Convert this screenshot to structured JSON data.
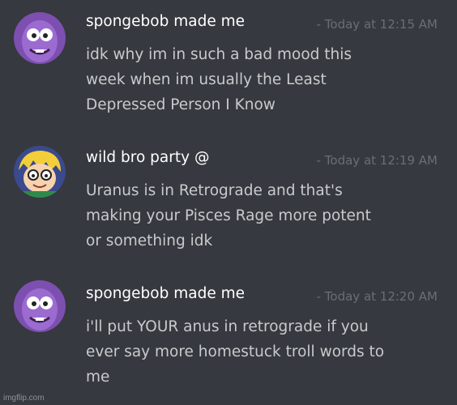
{
  "colors": {
    "background": "#36393f",
    "username": "#ffffff",
    "message_text": "#c9cacc",
    "timestamp": "#6a6e75"
  },
  "messages": [
    {
      "username": "spongebob made me",
      "timestamp": "- Today at 12:15 AM",
      "avatar": "purple-cartoon-character-avatar",
      "lines": [
        "idk why im in such a bad mood this",
        "week when im usually the Least",
        "Depressed Person I Know"
      ]
    },
    {
      "username": "wild bro party @",
      "timestamp": "- Today at 12:19 AM",
      "avatar": "blonde-cartoon-character-avatar",
      "lines": [
        "Uranus is in Retrograde and that's",
        "making your Pisces Rage more potent",
        "or something idk"
      ]
    },
    {
      "username": "spongebob made me",
      "timestamp": "- Today at 12:20 AM",
      "avatar": "purple-cartoon-character-avatar",
      "lines": [
        "i'll put YOUR anus in retrograde if you",
        "ever say more homestuck troll words to",
        "me"
      ]
    }
  ],
  "watermark": "imgflip.com"
}
